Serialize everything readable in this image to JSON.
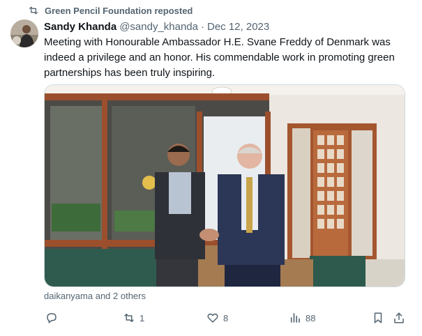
{
  "repost": {
    "label": "Green Pencil Foundation reposted",
    "icon": "repost-icon"
  },
  "author": {
    "display_name": "Sandy Khanda",
    "handle": "@sandy_khanda",
    "separator": "·",
    "date": "Dec 12, 2023"
  },
  "tweet_text": "Meeting with Honourable Ambassador H.E. Svane Freddy of Denmark was indeed a privilege and an honor. His commendable work in promoting green partnerships has been truly inspiring.",
  "likers": "daikanyama and 2 others",
  "actions": {
    "reply": {
      "icon": "reply-icon",
      "count": ""
    },
    "repost": {
      "icon": "repost-icon",
      "count": "1"
    },
    "like": {
      "icon": "heart-icon",
      "count": "8"
    },
    "views": {
      "icon": "views-chart-icon",
      "count": "88"
    },
    "bookmark": {
      "icon": "bookmark-icon"
    },
    "share": {
      "icon": "share-icon"
    }
  },
  "colors": {
    "text_primary": "#0f1419",
    "text_secondary": "#536471",
    "border": "#cfd9de"
  }
}
